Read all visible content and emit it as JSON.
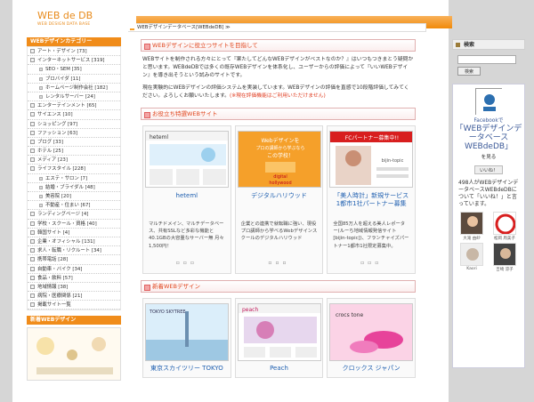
{
  "site": {
    "logo_title": "WEB de DB",
    "logo_sub": "WEB DESIGN DATA BASE"
  },
  "left": {
    "category_heading": "WEBデザインカテゴリー",
    "categories": [
      {
        "label": "アート・デザイン [73]",
        "sub": false
      },
      {
        "label": "インターネットサービス [319]",
        "sub": false
      },
      {
        "label": "SEO・SEM [35]",
        "sub": true
      },
      {
        "label": "ブロバイダ [11]",
        "sub": true
      },
      {
        "label": "ホームページ制作会社 [182]",
        "sub": true
      },
      {
        "label": "レンタルサーバー [24]",
        "sub": true
      },
      {
        "label": "エンターテインメント [65]",
        "sub": false
      },
      {
        "label": "サイエンス [10]",
        "sub": false
      },
      {
        "label": "ショッピング [97]",
        "sub": false
      },
      {
        "label": "ファッション [63]",
        "sub": false
      },
      {
        "label": "ブログ [33]",
        "sub": false
      },
      {
        "label": "ホテル [25]",
        "sub": false
      },
      {
        "label": "メディア [23]",
        "sub": false
      },
      {
        "label": "ライフスタイル [228]",
        "sub": false
      },
      {
        "label": "エステ・サロン [7]",
        "sub": true
      },
      {
        "label": "結婚・ブライダル [48]",
        "sub": true
      },
      {
        "label": "美容院 [20]",
        "sub": true
      },
      {
        "label": "不動産・住まい [67]",
        "sub": true
      },
      {
        "label": "ランディングページ [4]",
        "sub": false
      },
      {
        "label": "学校・スクール・資格 [40]",
        "sub": false
      },
      {
        "label": "韓国サイト [4]",
        "sub": false
      },
      {
        "label": "企業・オフィシャル [131]",
        "sub": false
      },
      {
        "label": "求人・転職・リクルート [34]",
        "sub": false
      },
      {
        "label": "携帯電話 [28]",
        "sub": false
      },
      {
        "label": "自動車・バイク [34]",
        "sub": false
      },
      {
        "label": "食品・飲料 [57]",
        "sub": false
      },
      {
        "label": "地域情報 [38]",
        "sub": false
      },
      {
        "label": "病院・医療関係 [21]",
        "sub": false
      },
      {
        "label": "掲載サイト一覧",
        "sub": false
      }
    ],
    "new_heading": "新着WEBデザイン"
  },
  "main": {
    "breadcrumb": "WEBデザインデータベース[WEBdeDB] ≫",
    "intro_heading": "WEBデザインに役立つサイトを目指して",
    "intro_p1": "WEBサイトを制作される方々にとって『果たしてどんなWEBデザインがベストなのか？』はいつもつきまとう疑問かと思います。WEBdeDBでは多くの既存WEBデザインを体系化し、ユーザーからの評価によって『いいWEBデザイン』を導き出そうという試みのサイトです。",
    "intro_p2": "現在実験的にWEBデザインの評価システムを実装しています。WEBデザインの評価を直感で10段階評価してみてください。よろしくお願いいたします。",
    "intro_p2_red": "(※現在評価機能はご利用いただけません)",
    "featured_heading": "お役立ち特選WEBサイト",
    "featured": [
      {
        "title": "heteml",
        "desc": "マルチドメイン、マルチデータベース、共有SSLなど多彩な機能と40.1GBの大容量なサーバー無 月々1,500円！"
      },
      {
        "title": "デジタルハリウッド",
        "desc": "企業との連携で就転職に強い、現役プロ講師から学べるWebデザインスクールのデジタルハリウッド"
      },
      {
        "title": "「美人時計」新規サービス1都市1社パートナー募集",
        "desc": "全国85万人を超える美人レポーター(ルーち地域情報発信サイト[bijin-topic])、フランチャイズパートナー1都市1社限定募集中。"
      }
    ],
    "featured_img_text": [
      {
        "a": "heteml",
        "b": ""
      },
      {
        "a": "Webデザインを",
        "b": "プロの講師から学ぶなら",
        "c": "この学校！",
        "d": "digital",
        "e": "hollywood"
      },
      {
        "a": "FCパートナー募集中!!",
        "b": "bijin-topic"
      }
    ],
    "new_heading": "新着WEBデザイン",
    "new_items": [
      {
        "title": "東京スカイツリー TOKYO"
      },
      {
        "title": "Peach"
      },
      {
        "title": "クロックス ジャパン"
      }
    ],
    "new_img_text": [
      {
        "a": "TOKYO SKYTREE"
      },
      {
        "a": "peach"
      },
      {
        "a": "crocs tone"
      }
    ]
  },
  "right": {
    "search_heading": "検索",
    "search_value": "",
    "search_button": "検索",
    "fb_line1": "Facebookで",
    "fb_name": "「WEBデザインデータベースWEBdeDB」",
    "fb_line3": "を見る",
    "fb_like": "いいね！",
    "fb_count": "498人がWEBデザインデータベースWEBdeDBについて「いいね！」と言っています。",
    "fans": [
      {
        "name": "大滝 由紗"
      },
      {
        "name": "松岡 周美子"
      },
      {
        "name": "Kaori"
      },
      {
        "name": "吉崎 涼子"
      }
    ],
    "colors": {
      "accent": "#f08c1a",
      "link": "#3b5998"
    }
  }
}
